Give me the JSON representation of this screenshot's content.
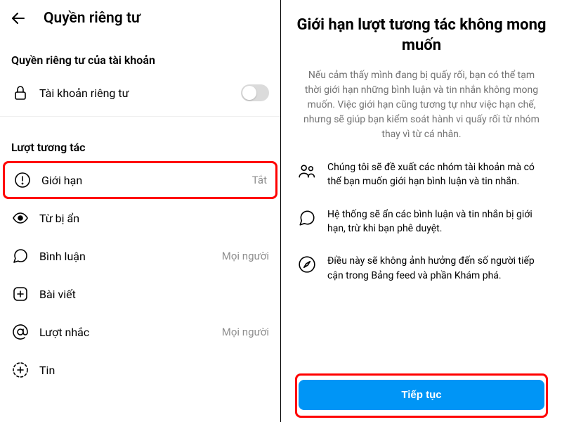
{
  "left": {
    "title": "Quyền riêng tư",
    "section_account": "Quyền riêng tư của tài khoản",
    "private_account_label": "Tài khoản riêng tư",
    "section_interactions": "Lượt tương tác",
    "rows": {
      "limits": {
        "label": "Giới hạn",
        "value": "Tắt"
      },
      "hidden_words": {
        "label": "Từ bị ẩn"
      },
      "comments": {
        "label": "Bình luận",
        "value": "Mọi người"
      },
      "posts": {
        "label": "Bài viết"
      },
      "mentions": {
        "label": "Lượt nhắc",
        "value": "Mọi người"
      },
      "stories": {
        "label": "Tin"
      }
    }
  },
  "right": {
    "title": "Giới hạn lượt tương tác không mong muốn",
    "description": "Nếu cảm thấy mình đang bị quấy rối, bạn có thể tạm thời giới hạn những bình luận và tin nhắn không mong muốn. Việc giới hạn cũng tương tự như việc hạn chế, nhưng sẽ giúp bạn kiểm soát hành vi quấy rối từ nhóm thay vì từ cá nhân.",
    "bullet1": "Chúng tôi sẽ đề xuất các nhóm tài khoản mà có thể bạn muốn giới hạn bình luận và tin nhắn.",
    "bullet2": "Hệ thống sẽ ẩn các bình luận và tin nhắn bị giới hạn, trừ khi bạn phê duyệt.",
    "bullet3": "Điều này sẽ không ảnh hưởng đến số người tiếp cận trong Bảng feed và phần Khám phá.",
    "continue_label": "Tiếp tục"
  }
}
